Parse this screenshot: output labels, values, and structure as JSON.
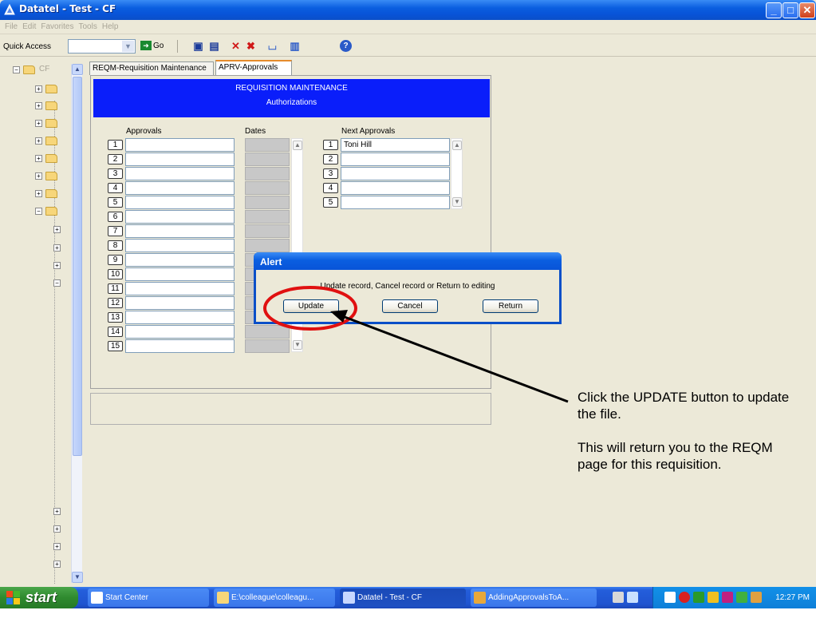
{
  "window": {
    "title": "Datatel - Test - CF"
  },
  "menu": [
    "File",
    "Edit",
    "Favorites",
    "Tools",
    "Help"
  ],
  "toolbar": {
    "quick_access_label": "Quick Access",
    "go_label": "Go"
  },
  "tree": {
    "root_label": "CF"
  },
  "tabs": [
    {
      "label": "REQM-Requisition Maintenance",
      "active": false
    },
    {
      "label": "APRV-Approvals",
      "active": true
    }
  ],
  "form": {
    "banner_title": "REQUISITION MAINTENANCE",
    "banner_subtitle": "Authorizations",
    "approvals_header": "Approvals",
    "dates_header": "Dates",
    "next_approvals_header": "Next Approvals",
    "approvals_rows": [
      "1",
      "2",
      "3",
      "4",
      "5",
      "6",
      "7",
      "8",
      "9",
      "10",
      "11",
      "12",
      "13",
      "14",
      "15"
    ],
    "next_approvals": [
      {
        "num": "1",
        "value": "Toni Hill"
      },
      {
        "num": "2",
        "value": ""
      },
      {
        "num": "3",
        "value": ""
      },
      {
        "num": "4",
        "value": ""
      },
      {
        "num": "5",
        "value": ""
      }
    ]
  },
  "alert": {
    "title": "Alert",
    "message": "Update record, Cancel record or Return to editing",
    "update_label": "Update",
    "cancel_label": "Cancel",
    "return_label": "Return"
  },
  "annotation": {
    "line1": "Click the UPDATE button to update the file.",
    "line2": "This will return you to the REQM page for this requisition.",
    "highlight_color": "#e01010"
  },
  "taskbar": {
    "start_label": "start",
    "items": [
      {
        "label": "Start Center",
        "active": false
      },
      {
        "label": "E:\\colleague\\colleagu...",
        "active": false
      },
      {
        "label": "Datatel - Test - CF",
        "active": true
      },
      {
        "label": "AddingApprovalsToA...",
        "active": false
      }
    ],
    "clock": "12:27 PM"
  }
}
